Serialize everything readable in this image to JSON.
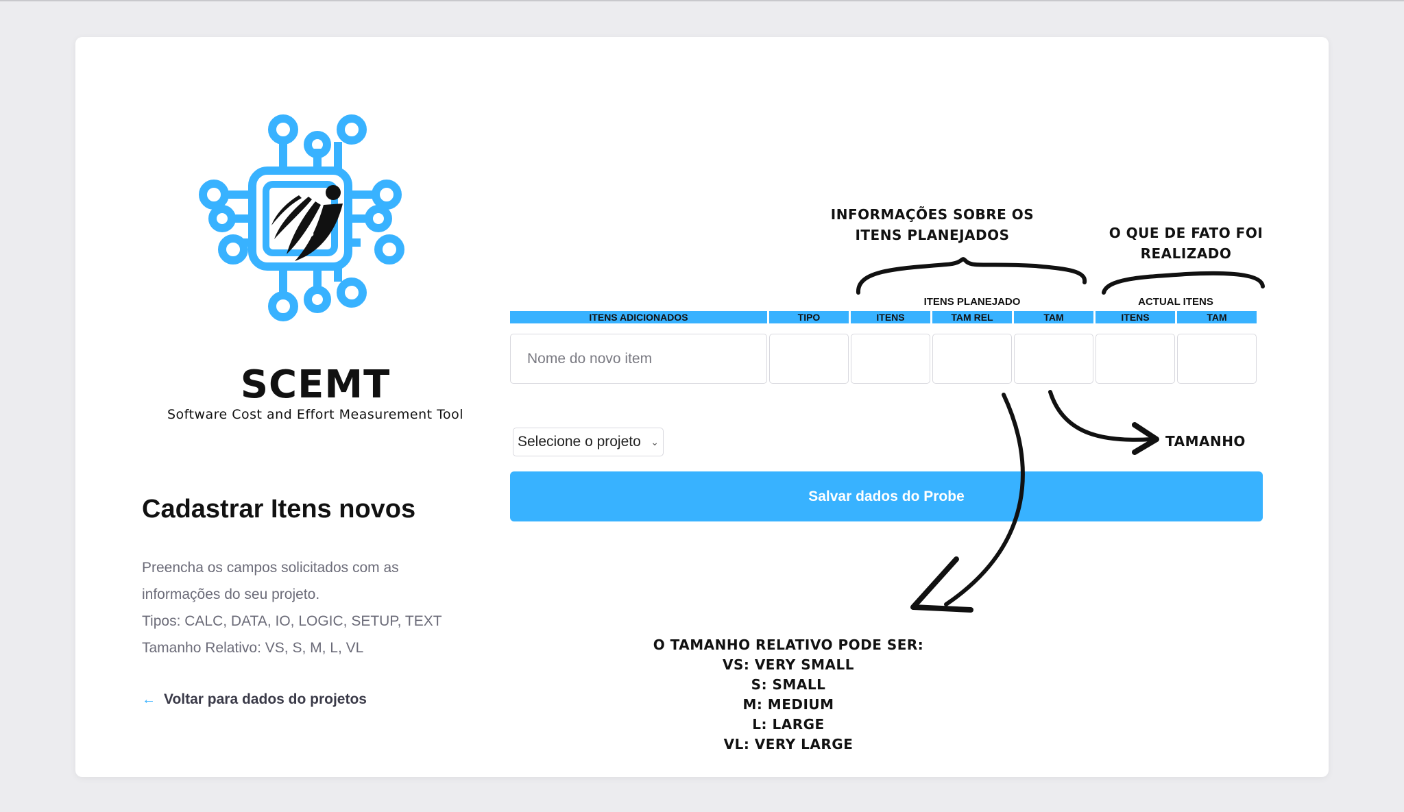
{
  "logo": {
    "title": "SCEMT",
    "subtitle": "Software Cost and Effort Measurement Tool"
  },
  "left": {
    "title": "Cadastrar Itens novos",
    "desc_lines": [
      "Preencha os campos solicitados com as",
      "informações do seu projeto.",
      "Tipos: CALC, DATA, IO, LOGIC, SETUP, TEXT",
      "Tamanho Relativo: VS, S, M, L, VL"
    ],
    "back_link": "Voltar para dados do projetos"
  },
  "table": {
    "group_planned": "ITENS PLANEJADO",
    "group_actual": "ACTUAL ITENS",
    "columns": [
      "ITENS ADICIONADOS",
      "TIPO",
      "ITENS",
      "TAM REL",
      "TAM",
      "ITENS",
      "TAM"
    ],
    "new_item_placeholder": "Nome do novo item"
  },
  "project_select": {
    "selected": "Selecione o projeto"
  },
  "save_button": "Salvar dados do Probe",
  "annotations": {
    "planned_info": [
      "INFORMAÇÕES SOBRE OS",
      "ITENS PLANEJADOS"
    ],
    "actual_info": [
      "O QUE DE FATO FOI",
      "REALIZADO"
    ],
    "tamanho": "TAMANHO",
    "relative_size": [
      "O TAMANHO RELATIVO PODE SER:",
      "VS: VERY SMALL",
      "S: SMALL",
      "M: MEDIUM",
      "L: LARGE",
      "VL: VERY LARGE"
    ]
  },
  "colors": {
    "accent": "#38b2ff",
    "background": "#ececef"
  },
  "icons": {
    "back": "arrow-left-icon",
    "select": "chevron-down-icon",
    "logo": "circuit-chip-logo"
  }
}
